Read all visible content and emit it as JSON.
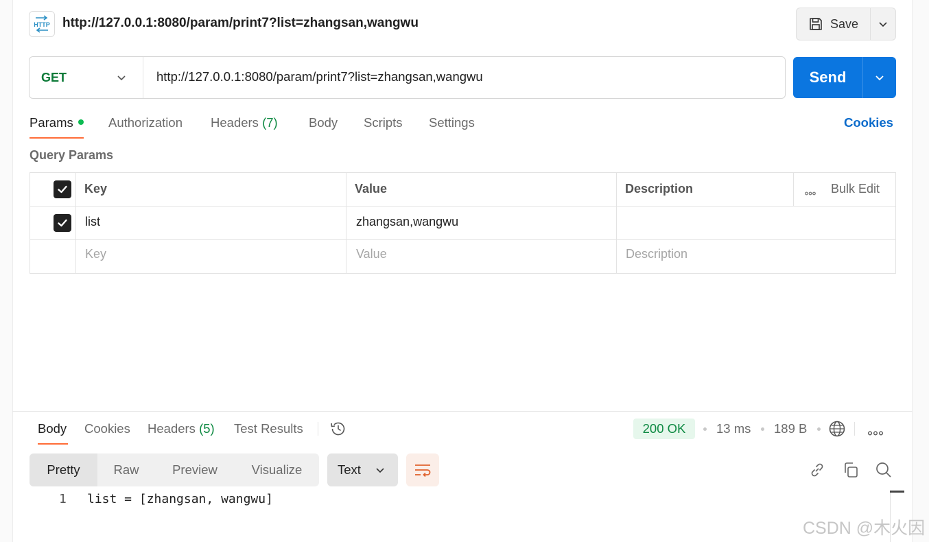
{
  "header": {
    "icon": "http-icon",
    "icon_text": "HTTP",
    "request_title": "http://127.0.0.1:8080/param/print7?list=zhangsan,wangwu",
    "save_label": "Save"
  },
  "url_bar": {
    "method": "GET",
    "url": "http://127.0.0.1:8080/param/print7?list=zhangsan,wangwu",
    "send_label": "Send"
  },
  "request_tabs": {
    "params": "Params",
    "authorization": "Authorization",
    "headers": "Headers",
    "headers_count": "(7)",
    "body": "Body",
    "scripts": "Scripts",
    "settings": "Settings",
    "cookies": "Cookies"
  },
  "query_params": {
    "section_title": "Query Params",
    "columns": {
      "key": "Key",
      "value": "Value",
      "description": "Description",
      "bulk_edit": "Bulk Edit"
    },
    "rows": [
      {
        "checked": true,
        "key": "list",
        "value": "zhangsan,wangwu",
        "description": ""
      }
    ],
    "placeholders": {
      "key": "Key",
      "value": "Value",
      "description": "Description"
    }
  },
  "response": {
    "tabs": {
      "body": "Body",
      "cookies": "Cookies",
      "headers": "Headers",
      "headers_count": "(5)",
      "test_results": "Test Results"
    },
    "status": "200 OK",
    "time": "13 ms",
    "size": "189 B",
    "view_modes": [
      "Pretty",
      "Raw",
      "Preview",
      "Visualize"
    ],
    "format": "Text",
    "code_lines": [
      {
        "number": "1",
        "text": "list = [zhangsan, wangwu]"
      }
    ]
  },
  "watermark": "CSDN @木火因",
  "colors": {
    "accent_orange": "#ff6c37",
    "send_blue": "#0b76e0",
    "get_green": "#0c7a38",
    "status_green_bg": "#e6f7ec"
  }
}
